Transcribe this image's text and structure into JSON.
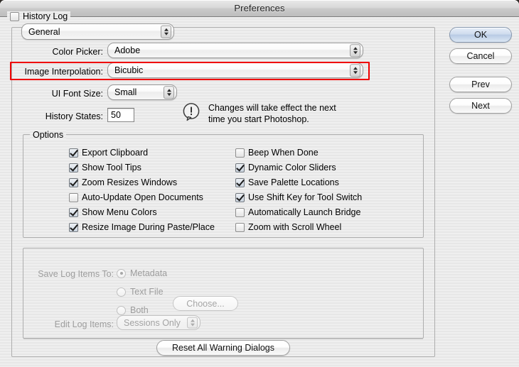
{
  "window": {
    "title": "Preferences"
  },
  "panel_selector": {
    "label": "panel-selector",
    "value": "General"
  },
  "fields": {
    "color_picker": {
      "label": "Color Picker:",
      "value": "Adobe"
    },
    "image_interpolation": {
      "label": "Image Interpolation:",
      "value": "Bicubic",
      "highlight_color": "#ef0000"
    },
    "ui_font_size": {
      "label": "UI Font Size:",
      "value": "Small"
    },
    "history_states": {
      "label": "History States:",
      "value": "50"
    }
  },
  "notice": {
    "icon": "warning-bubble-icon",
    "line1": "Changes will take effect the next",
    "line2": "time you start Photoshop."
  },
  "options": {
    "legend": "Options",
    "left_column": [
      {
        "label": "Export Clipboard",
        "checked": true
      },
      {
        "label": "Show Tool Tips",
        "checked": true
      },
      {
        "label": "Zoom Resizes Windows",
        "checked": true
      },
      {
        "label": "Auto-Update Open Documents",
        "checked": false
      },
      {
        "label": "Show Menu Colors",
        "checked": true
      },
      {
        "label": "Resize Image During Paste/Place",
        "checked": true
      }
    ],
    "right_column": [
      {
        "label": "Beep When Done",
        "checked": false
      },
      {
        "label": "Dynamic Color Sliders",
        "checked": true
      },
      {
        "label": "Save Palette Locations",
        "checked": true
      },
      {
        "label": "Use Shift Key for Tool Switch",
        "checked": true
      },
      {
        "label": "Automatically Launch Bridge",
        "checked": false
      },
      {
        "label": "Zoom with Scroll Wheel",
        "checked": false
      }
    ]
  },
  "history_log": {
    "legend": "History Log",
    "enabled": false,
    "save_log_items_label": "Save Log Items To:",
    "radios": [
      {
        "label": "Metadata",
        "selected": true
      },
      {
        "label": "Text File",
        "selected": false
      },
      {
        "label": "Both",
        "selected": false
      }
    ],
    "choose_button": "Choose...",
    "edit_log_items_label": "Edit Log Items:",
    "edit_log_items_value": "Sessions Only"
  },
  "reset_button": {
    "label": "Reset All Warning Dialogs"
  },
  "side_buttons": [
    {
      "label": "OK",
      "default": true
    },
    {
      "label": "Cancel",
      "default": false
    },
    {
      "label": "Prev",
      "default": false
    },
    {
      "label": "Next",
      "default": false
    }
  ]
}
